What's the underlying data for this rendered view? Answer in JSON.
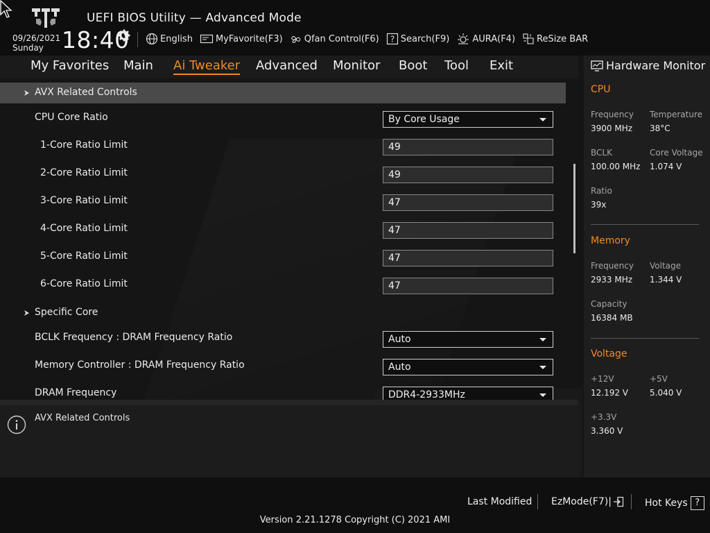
{
  "header": {
    "title": "UEFI BIOS Utility — Advanced Mode",
    "date": "09/26/2021",
    "day": "Sunday",
    "time": "18:40",
    "toolbar": [
      {
        "label": "English",
        "icon": "globe-icon"
      },
      {
        "label": "MyFavorite(F3)",
        "icon": "favorite-icon"
      },
      {
        "label": "Qfan Control(F6)",
        "icon": "fan-icon"
      },
      {
        "label": "Search(F9)",
        "icon": "search-icon"
      },
      {
        "label": "AURA(F4)",
        "icon": "aura-icon"
      },
      {
        "label": "ReSize BAR",
        "icon": "resize-bar-icon"
      }
    ]
  },
  "tabs": [
    "My Favorites",
    "Main",
    "Ai Tweaker",
    "Advanced",
    "Monitor",
    "Boot",
    "Tool",
    "Exit"
  ],
  "active_tab": "Ai Tweaker",
  "settings": [
    {
      "label": "AVX Related Controls",
      "type": "submenu",
      "selected": true
    },
    {
      "label": "CPU Core Ratio",
      "type": "select",
      "value": "By Core Usage"
    },
    {
      "label": "1-Core Ratio Limit",
      "type": "input",
      "value": "49"
    },
    {
      "label": "2-Core Ratio Limit",
      "type": "input",
      "value": "49"
    },
    {
      "label": "3-Core Ratio Limit",
      "type": "input",
      "value": "47"
    },
    {
      "label": "4-Core Ratio Limit",
      "type": "input",
      "value": "47"
    },
    {
      "label": "5-Core Ratio Limit",
      "type": "input",
      "value": "47"
    },
    {
      "label": "6-Core Ratio Limit",
      "type": "input",
      "value": "47"
    },
    {
      "label": "Specific Core",
      "type": "submenu"
    },
    {
      "label": "BCLK Frequency : DRAM Frequency Ratio",
      "type": "select",
      "value": "Auto"
    },
    {
      "label": "Memory Controller : DRAM Frequency Ratio",
      "type": "select",
      "value": "Auto"
    },
    {
      "label": "DRAM Frequency",
      "type": "select",
      "value": "DDR4-2933MHz"
    }
  ],
  "help_text": "AVX Related Controls",
  "hardware_monitor": {
    "title": "Hardware Monitor",
    "cpu": {
      "title": "CPU",
      "frequency_label": "Frequency",
      "frequency": "3900 MHz",
      "temperature_label": "Temperature",
      "temperature": "38°C",
      "bclk_label": "BCLK",
      "bclk": "100.00 MHz",
      "core_voltage_label": "Core Voltage",
      "core_voltage": "1.074 V",
      "ratio_label": "Ratio",
      "ratio": "39x"
    },
    "memory": {
      "title": "Memory",
      "frequency_label": "Frequency",
      "frequency": "2933 MHz",
      "voltage_label": "Voltage",
      "voltage": "1.344 V",
      "capacity_label": "Capacity",
      "capacity": "16384 MB"
    },
    "voltage": {
      "title": "Voltage",
      "v12_label": "+12V",
      "v12": "12.192 V",
      "v5_label": "+5V",
      "v5": "5.040 V",
      "v33_label": "+3.3V",
      "v33": "3.360 V"
    }
  },
  "footer": {
    "last_modified": "Last Modified",
    "ezmode": "EzMode(F7)|",
    "hot_keys": "Hot Keys",
    "hot_keys_key": "?",
    "version": "Version 2.21.1278 Copyright (C) 2021 AMI"
  },
  "colors": {
    "accent": "#f08a24",
    "selected_row": "#4a4a4a"
  }
}
